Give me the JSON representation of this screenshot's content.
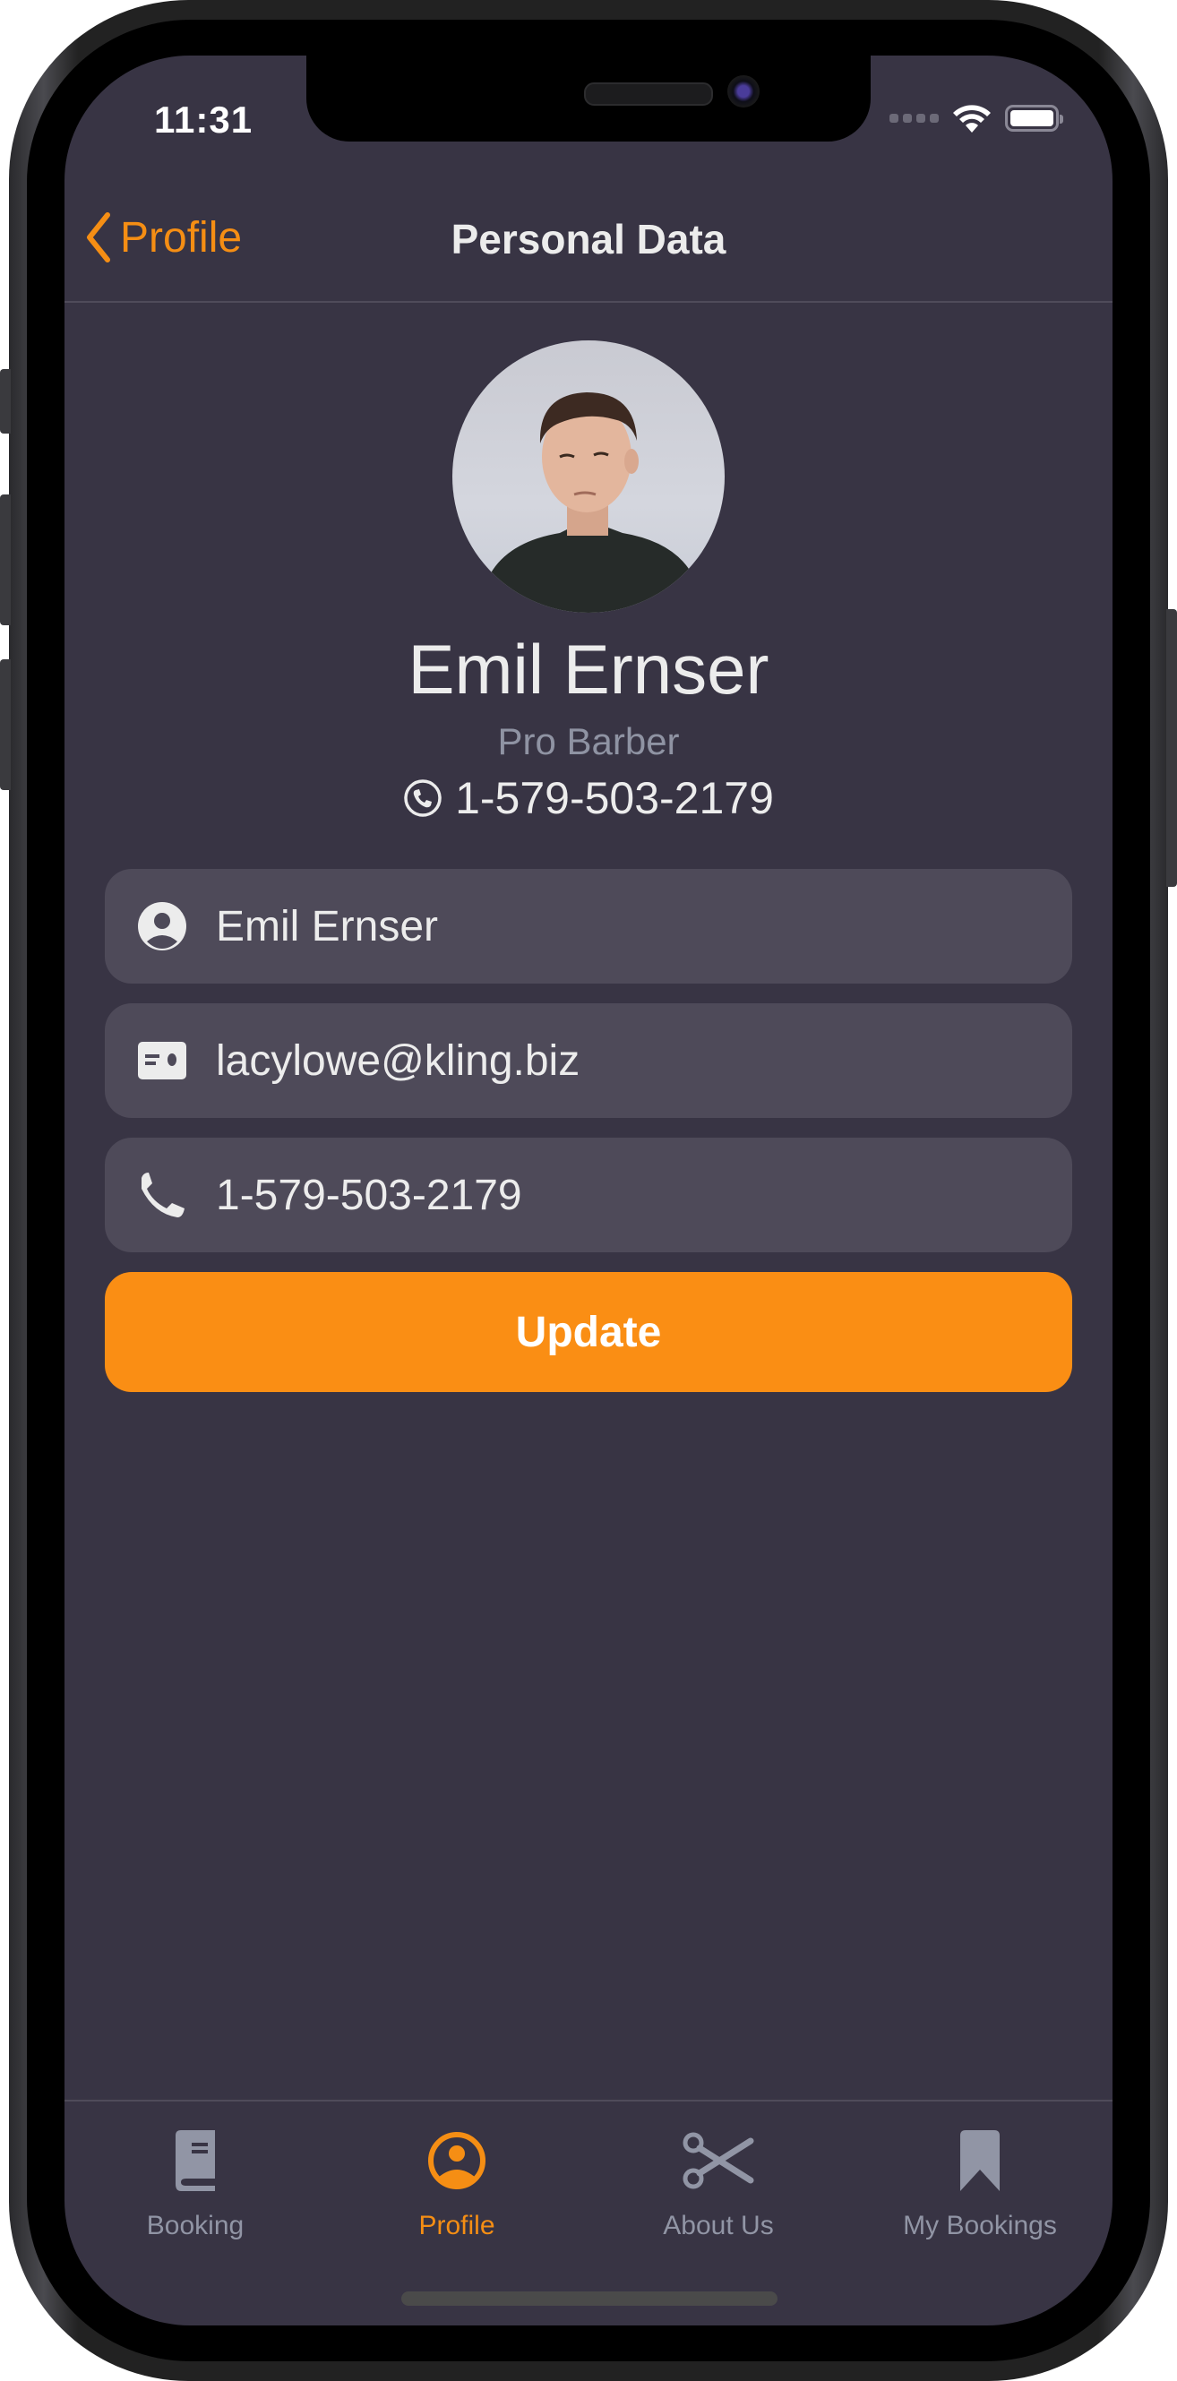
{
  "status_bar": {
    "time": "11:31",
    "wifi_icon": "wifi-icon",
    "battery_icon": "battery-icon",
    "signal_icon": "signal-icon"
  },
  "nav": {
    "back_label": "Profile",
    "back_icon": "chevron-left-icon",
    "title": "Personal Data"
  },
  "profile": {
    "name": "Emil Ernser",
    "role": "Pro Barber",
    "phone": "1-579-503-2179",
    "phone_icon": "phone-circle-icon",
    "avatar": "avatar-photo"
  },
  "form": {
    "fields": [
      {
        "icon": "person-circle-icon",
        "value": "Emil Ernser"
      },
      {
        "icon": "id-card-icon",
        "value": "lacylowe@kling.biz"
      },
      {
        "icon": "phone-icon",
        "value": "1-579-503-2179"
      }
    ],
    "update_label": "Update"
  },
  "tabs": [
    {
      "label": "Booking",
      "icon": "book-icon",
      "active": false
    },
    {
      "label": "Profile",
      "icon": "person-circle-icon",
      "active": true
    },
    {
      "label": "About Us",
      "icon": "scissors-icon",
      "active": false
    },
    {
      "label": "My Bookings",
      "icon": "bookmark-icon",
      "active": false
    }
  ],
  "colors": {
    "accent": "#F58E14",
    "background": "#383444",
    "field": "#4E4A59",
    "muted": "#9195A5",
    "text": "#ECECEC"
  }
}
